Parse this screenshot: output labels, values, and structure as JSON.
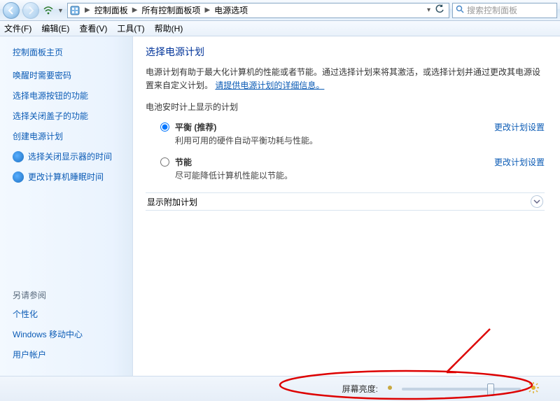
{
  "toolbar": {
    "search_placeholder": "搜索控制面板",
    "breadcrumb": [
      "控制面板",
      "所有控制面板项",
      "电源选项"
    ]
  },
  "menubar": {
    "file": "文件(F)",
    "edit": "编辑(E)",
    "view": "查看(V)",
    "tools": "工具(T)",
    "help": "帮助(H)"
  },
  "sidebar": {
    "home": "控制面板主页",
    "links": [
      "唤醒时需要密码",
      "选择电源按钮的功能",
      "选择关闭盖子的功能",
      "创建电源计划"
    ],
    "shield_links": [
      "选择关闭显示器的时间",
      "更改计算机睡眠时间"
    ],
    "see_also_label": "另请参阅",
    "see_also": [
      "个性化",
      "Windows 移动中心",
      "用户帐户"
    ]
  },
  "content": {
    "title": "选择电源计划",
    "desc_prefix": "电源计划有助于最大化计算机的性能或者节能。通过选择计划来将其激活，或选择计划并通过更改其电源设置来自定义计划。",
    "desc_link": "请提供电源计划的详细信息。",
    "section_battery": "电池安时计上显示的计划",
    "plan_balanced_title": "平衡 (推荐)",
    "plan_balanced_sub": "利用可用的硬件自动平衡功耗与性能。",
    "plan_saver_title": "节能",
    "plan_saver_sub": "尽可能降低计算机性能以节能。",
    "change_settings": "更改计划设置",
    "show_more": "显示附加计划"
  },
  "bottom": {
    "brightness_label": "屏幕亮度:",
    "brightness_value": 75
  }
}
